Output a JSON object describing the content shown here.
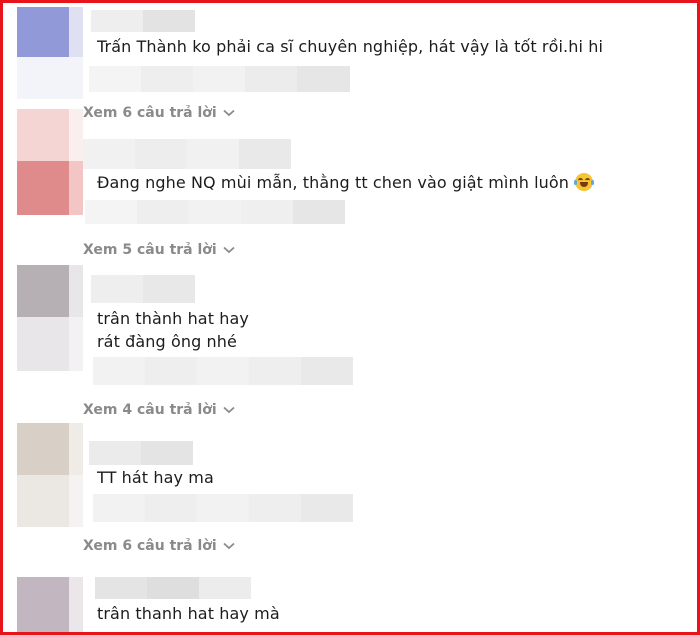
{
  "comments": [
    {
      "text": "Trấn Thành ko phải ca sĩ chuyên nghiệp, hát vậy là tốt rồi.hi hi",
      "replies": "Xem 6 câu trả lời"
    },
    {
      "text": "Đang nghe NQ mùi mẫn, thằng tt chen vào giật mình luôn",
      "emoji": "laughing-tears-emoji",
      "replies": "Xem 5 câu trả lời"
    },
    {
      "text_lines": [
        "trân thành hat hay",
        "rát đàng ông nhé"
      ],
      "replies": "Xem 4 câu trả lời"
    },
    {
      "text": "TT hát hay ma",
      "replies": "Xem 6 câu trả lời"
    },
    {
      "text": "trân thanh hat hay mà"
    }
  ],
  "colors": {
    "frame_border": "#e8141c",
    "text": "#1c1c1c",
    "replies_link": "#8a8a8a"
  },
  "icons": {
    "expand": "chevron-down-icon"
  }
}
